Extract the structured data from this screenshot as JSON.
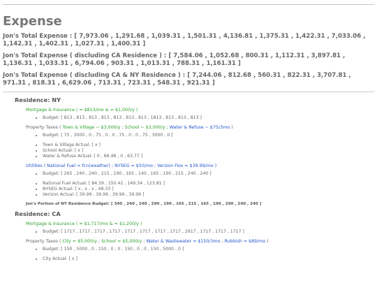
{
  "title": "Expense",
  "totals": [
    "Jon's Total Expense : [ 7,973.06 , 1,291.68 , 1,039.31 , 1,501.31 , 4,136.81 , 1,375.31 , 1,422.31 , 7,033.06 , 1,142.31 , 1,402.31 , 1,027.31 , 1,400.31 ]",
    "Jon's Total Expense ( discluding CA Residence ) : [ 7,584.06 , 1,052.68 , 800.31 , 1,112.31 , 3,897.81 , 1,136.31 , 1,033.31 , 6,794.06 , 903.31 , 1,013.31 , 788.31 , 1,161.31 ]",
    "Jon's Total Expense ( discluding CA & NY Residence ) : [ 7,244.06 , 812.68 , 560.31 , 822.31 , 3,707.81 , 971.31 , 818.31 , 6,629.06 , 713.31 , 723.31 , 548.31 , 921.31 ]"
  ],
  "ny": {
    "heading": "Residence: NY",
    "mortgage": {
      "title": "Mortgage & Insurance ( ≈ $813/mo & ≈ $1,000/y )",
      "budget": "Budget: [ 813 , 813 , 813 , 813 , 813 , 813 , 813 , 1813 , 813 , 813 , 813 ]"
    },
    "taxes": {
      "prefix": "Property Taxes ( ",
      "t1": "Town & Village ~ $3,000/y",
      "s1": " ; ",
      "t2": "School ~ $3,000/y",
      "s2": " ; ",
      "t3": "Water & Refuse ~ $75/3mo",
      "suffix": " )",
      "budget": "Budget: [ 75 , 3000 , 0 , 75 , 0 , 0 , 75 , 0 , 0 , 75 , 3000 , 0 ]",
      "actuals": [
        "Town & Village Actual: [ x ]",
        "School Actual: [ x ]",
        "Water & Refuse Actual: [ 0 , 66.48 , 0 , 63.77 ]"
      ]
    },
    "utilities": {
      "prefix": "Utilities ( ",
      "t1": "National Fuel ≈ fcn(weather)",
      "s1": " ; ",
      "t2": "NYSEG ≈ $50/mo",
      "s2": " ; ",
      "t3": "Verizon Fios ≈ $39.99/mo",
      "suffix": " )",
      "budget": "Budget: [ 265 , 240 , 240 , 215 , 190 , 165 , 140 , 165 , 190 , 215 , 240 , 240 ]",
      "actuals": [
        "National Fuel Actual: [ 84.39 , 150.42 , 149.34 , 123.81 ]",
        "NYSEG Actual: [ x , x , x , 48.33 ]",
        "Verizon Actual: [ 39.99 , 39.99 , 39.99 , 39.99 ]"
      ]
    },
    "portion": "Jon's Portion of NY Residence Budget: [ 340 , 240 , 240 , 290 , 190 , 165 , 215 , 165 , 190 , 290 , 240 , 240 ]"
  },
  "ca": {
    "heading": "Residence: CA",
    "mortgage": {
      "title": "Mortgage & Insurance ( ≈ $1,717/mo & ≈ $1,200/y )",
      "budget": "Budget: [ 1717 , 1717 , 1717 , 1717 , 1717 , 1717 , 1717 , 1717 , 2917 , 1717 , 1717 , 1717 ]"
    },
    "taxes": {
      "prefix": "Property Taxes ( ",
      "t1": "City ≈ $5,000/y",
      "s1": " ; ",
      "t2": "School ≈ $5,000/y",
      "s2": " ; ",
      "t3": "Water & Wastewater ≈ $150/3mo",
      "s3": " ; ",
      "t4": "Rubbish ≈ $89/mo",
      "suffix": " )",
      "budget": "Budget: [ 150 , 5000 , 0 , 150 , 0 , 0 , 150 , 0 , 0 , 150 , 5000 , 0 ]",
      "actuals": [
        "City Actual: [ x ]"
      ]
    }
  }
}
